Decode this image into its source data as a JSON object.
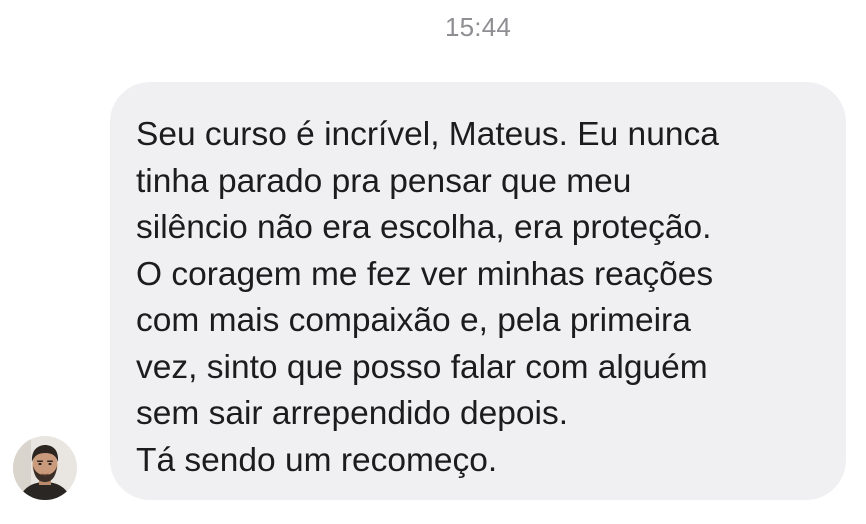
{
  "conversation": {
    "timestamp": "15:44",
    "message": {
      "lines": [
        "Seu curso é incrível, Mateus. Eu nunca",
        "tinha parado pra pensar que meu",
        "silêncio não era escolha, era proteção.",
        "O coragem me fez ver minhas reações",
        "com mais compaixão e, pela primeira",
        "vez, sinto que posso falar com alguém",
        "sem sair arrependido depois.",
        "Tá sendo um recomeço."
      ]
    },
    "sender": {
      "avatar_icon": "user-photo-avatar"
    }
  },
  "colors": {
    "background": "#ffffff",
    "bubble": "#f0f0f2",
    "text": "#1c1c1e",
    "timestamp": "#8e8e93"
  }
}
